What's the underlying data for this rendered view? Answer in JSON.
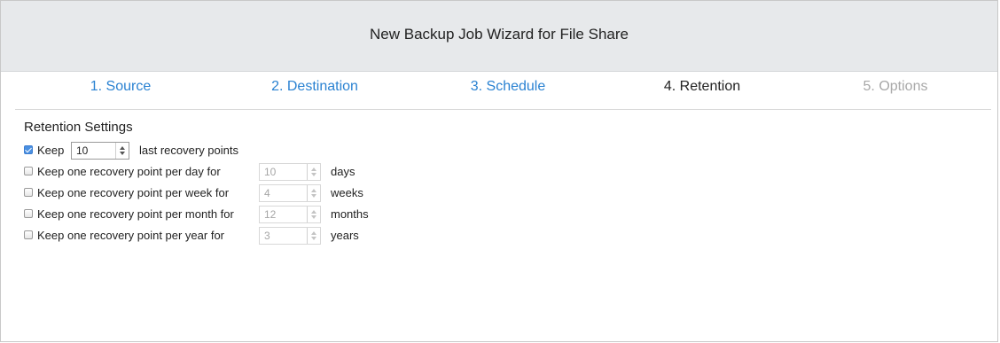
{
  "window": {
    "title": "New Backup Job Wizard for File Share"
  },
  "steps": [
    {
      "label": "1. Source",
      "state": "link"
    },
    {
      "label": "2. Destination",
      "state": "link"
    },
    {
      "label": "3. Schedule",
      "state": "link"
    },
    {
      "label": "4. Retention",
      "state": "current"
    },
    {
      "label": "5. Options",
      "state": "disabled"
    }
  ],
  "retention": {
    "section_title": "Retention Settings",
    "keep_last": {
      "checked": true,
      "label": "Keep",
      "value": "10",
      "suffix": "last recovery points"
    },
    "per_day": {
      "checked": false,
      "label": "Keep one recovery point per day for",
      "value": "10",
      "suffix": "days"
    },
    "per_week": {
      "checked": false,
      "label": "Keep one recovery point per week for",
      "value": "4",
      "suffix": "weeks"
    },
    "per_month": {
      "checked": false,
      "label": "Keep one recovery point per month for",
      "value": "12",
      "suffix": "months"
    },
    "per_year": {
      "checked": false,
      "label": "Keep one recovery point per year for",
      "value": "3",
      "suffix": "years"
    }
  },
  "colors": {
    "link": "#2a82d2",
    "titlebar_bg": "#e7e9eb",
    "disabled_text": "#a8a8a8"
  }
}
